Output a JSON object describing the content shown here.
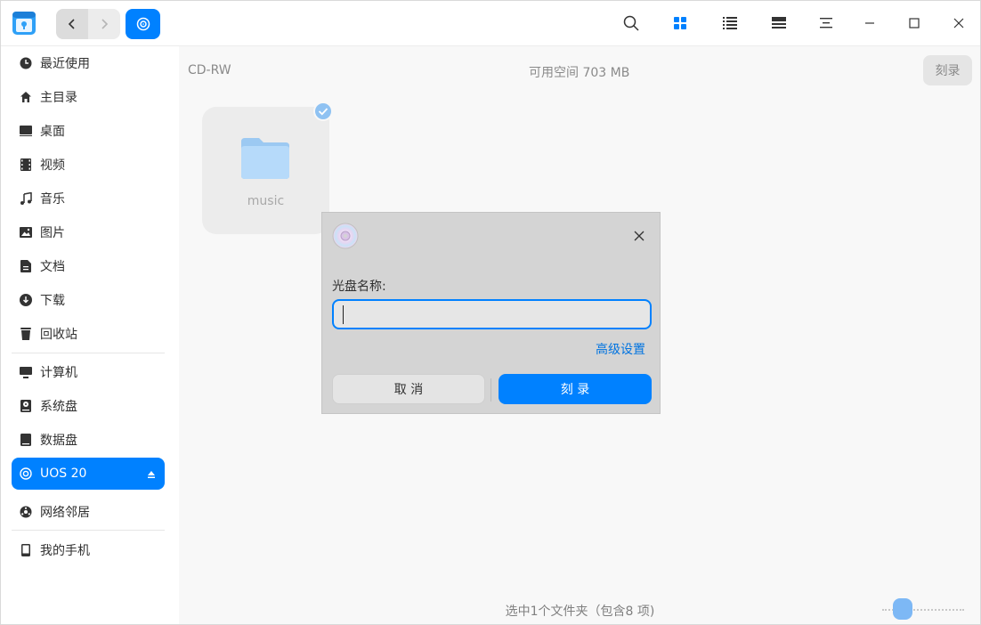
{
  "titlebar": {
    "back_label": "back",
    "forward_label": "forward"
  },
  "sidebar": {
    "items": [
      {
        "label": "最近使用",
        "icon": "clock-icon"
      },
      {
        "label": "主目录",
        "icon": "home-icon"
      },
      {
        "label": "桌面",
        "icon": "desktop-icon"
      },
      {
        "label": "视频",
        "icon": "video-icon"
      },
      {
        "label": "音乐",
        "icon": "music-icon"
      },
      {
        "label": "图片",
        "icon": "picture-icon"
      },
      {
        "label": "文档",
        "icon": "document-icon"
      },
      {
        "label": "下载",
        "icon": "download-icon"
      },
      {
        "label": "回收站",
        "icon": "trash-icon"
      },
      {
        "label": "计算机",
        "icon": "computer-icon"
      },
      {
        "label": "系统盘",
        "icon": "system-disk-icon"
      },
      {
        "label": "数据盘",
        "icon": "data-disk-icon"
      },
      {
        "label": "UOS 20",
        "icon": "optical-disc-icon",
        "active": true
      },
      {
        "label": "网络邻居",
        "icon": "network-icon"
      },
      {
        "label": "我的手机",
        "icon": "phone-icon"
      }
    ]
  },
  "main": {
    "disc_name": "CD-RW",
    "free_space": "可用空间 703 MB",
    "burn_button": "刻录",
    "folder_name": "music",
    "status": "选中1个文件夹（包含8 项)"
  },
  "dialog": {
    "label": "光盘名称:",
    "input_value": "",
    "advanced": "高级设置",
    "cancel": "取 消",
    "burn": "刻 录"
  },
  "colors": {
    "accent": "#0081ff",
    "dialog_bg": "#d4d4d4",
    "sidebar_bg": "#ffffff"
  }
}
